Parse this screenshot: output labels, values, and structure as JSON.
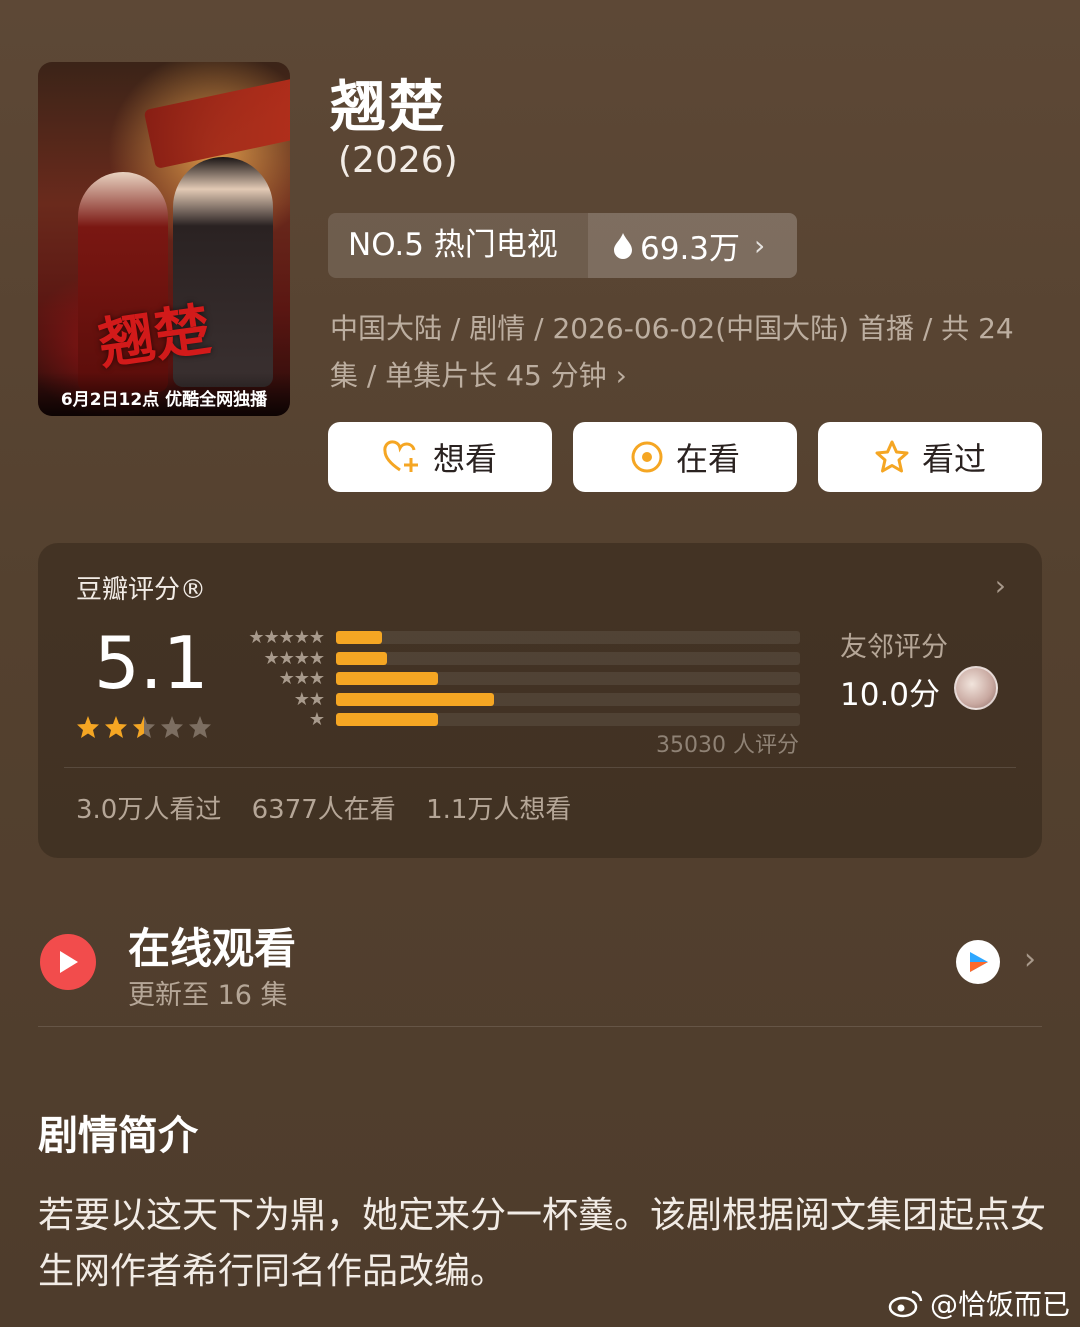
{
  "poster": {
    "calligraphy": "翘楚",
    "caption": "6月2日12点 优酷全网独播"
  },
  "show": {
    "title": "翘楚",
    "year": "(2026)"
  },
  "rank": {
    "label": "NO.5 热门电视",
    "heat": "69.3万"
  },
  "meta": "中国大陆 / 剧情 / 2026-06-02(中国大陆) 首播 / 共 24 集 / 单集片长 45 分钟",
  "actions": [
    {
      "label": "想看",
      "icon": "heart-plus-icon"
    },
    {
      "label": "在看",
      "icon": "target-icon"
    },
    {
      "label": "看过",
      "icon": "star-outline-icon"
    }
  ],
  "rating": {
    "label": "豆瓣评分®",
    "score": "5.1",
    "star_value": 2.5,
    "count": "35030 人评分",
    "distribution": [
      {
        "stars": 5,
        "fraction": 0.1
      },
      {
        "stars": 4,
        "fraction": 0.11
      },
      {
        "stars": 3,
        "fraction": 0.22
      },
      {
        "stars": 2,
        "fraction": 0.34
      },
      {
        "stars": 1,
        "fraction": 0.22
      }
    ],
    "friend_label": "友邻评分",
    "friend_score": "10.0分",
    "stats": [
      "3.0万人看过",
      "6377人在看",
      "1.1万人想看"
    ]
  },
  "online": {
    "title": "在线观看",
    "subtitle": "更新至 16 集"
  },
  "intro": {
    "title": "剧情简介",
    "text": "若要以这天下为鼎，她定来分一杯羹。该剧根据阅文集团起点女生网作者希行同名作品改编。"
  },
  "watermark": "@恰饭而已",
  "colors": {
    "accent": "#f5a623",
    "play": "#f24c4c"
  }
}
